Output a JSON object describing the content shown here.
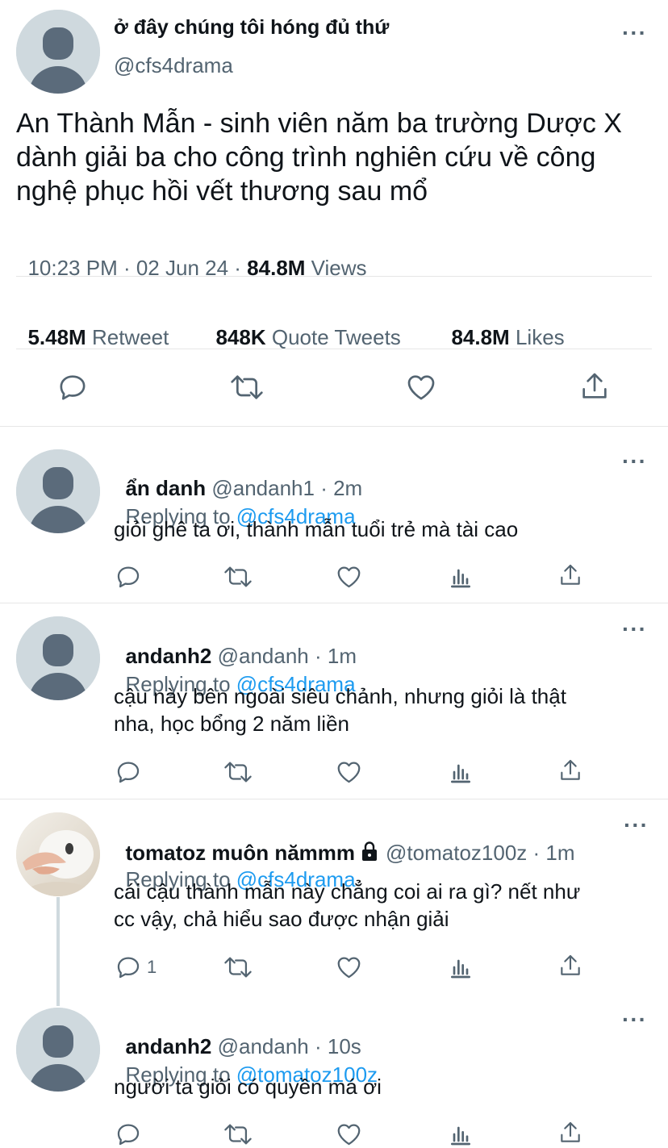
{
  "main_tweet": {
    "display_name": "ở đây chúng tôi hóng đủ thứ",
    "handle": "@cfs4drama",
    "text": "An Thành Mẫn - sinh viên năm ba trường Dược X dành giải ba cho công trình nghiên cứu về công nghệ phục hồi vết thương sau mổ",
    "time": "10:23 PM · 02 Jun 24 · ",
    "views_count": "84.8M",
    "views_label": " Views",
    "retweets_count": "5.48M",
    "retweets_label": "Retweet",
    "quotes_count": "848K",
    "quotes_label": "Quote Tweets",
    "likes_count": "84.8M",
    "likes_label": "Likes"
  },
  "replies": [
    {
      "name": "ẩn danh",
      "meta": "@andanh1 · 2m",
      "replying_label": "Replying to ",
      "replying_to": "@cfs4drama",
      "text": "giỏi ghê ta ơi, thành mẫn tuổi trẻ mà tài cao"
    },
    {
      "name": "andanh2",
      "meta": "@andanh · 1m",
      "replying_label": "Replying to ",
      "replying_to": "@cfs4drama",
      "text_line1": "cậu này bên ngoài siêu chảnh, nhưng giỏi là thật",
      "text_line2": "nha, học bổng 2 năm liền"
    },
    {
      "name": "tomatoz muôn nămmm",
      "meta": "@tomatoz100z · 1m",
      "replying_label": "Replying to ",
      "replying_to": "@cfs4drama",
      "text_line1": "cái cậu thành mẫn này chẳng coi ai ra gì? nết như",
      "text_line2": "cc vậy, chả hiểu sao được nhận giải",
      "reply_count": "1"
    },
    {
      "name": "andanh2",
      "meta": "@andanh · 10s",
      "replying_label": "Replying to ",
      "replying_to": "@tomatoz100z",
      "text": "người ta giỏi có quyền má ơi"
    }
  ],
  "colors": {
    "accent": "#1d9bf0",
    "muted": "#536471",
    "avatar_bg": "#cfd9de",
    "avatar_fg": "#5b6b7b"
  }
}
